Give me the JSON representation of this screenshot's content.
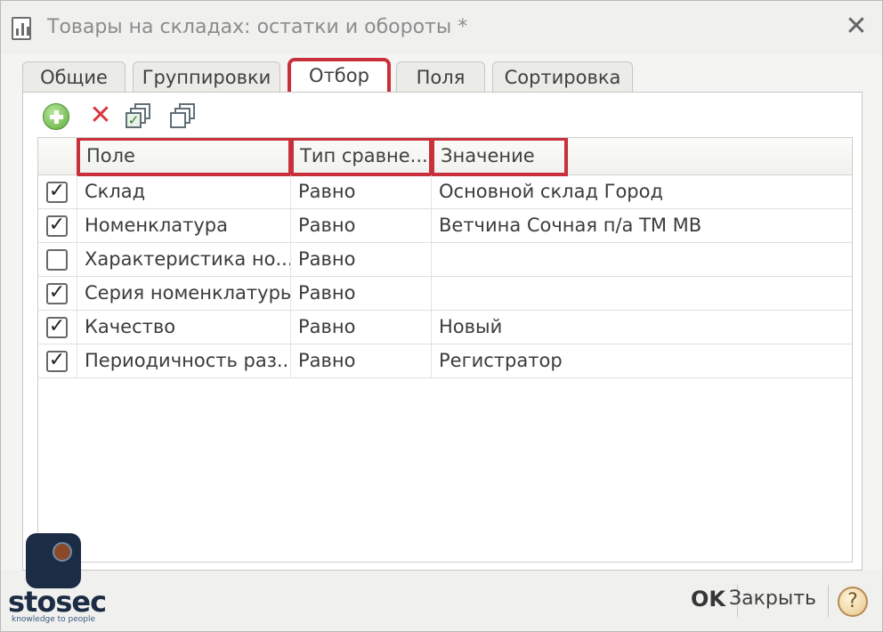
{
  "window": {
    "title": "Товары на складах: остатки и обороты *"
  },
  "tabs": [
    {
      "label": "Общие"
    },
    {
      "label": "Группировки"
    },
    {
      "label": "Отбор",
      "active": true
    },
    {
      "label": "Поля"
    },
    {
      "label": "Сортировка"
    }
  ],
  "toolbar": {
    "icons": [
      "add-icon",
      "delete-icon",
      "check-all-icon",
      "uncheck-all-icon"
    ]
  },
  "table": {
    "columns": [
      "Поле",
      "Тип сравне...",
      "Значение"
    ],
    "rows": [
      {
        "checked": true,
        "field": "Склад",
        "comparison": "Равно",
        "value": "Основной склад Город"
      },
      {
        "checked": true,
        "field": "Номенклатура",
        "comparison": "Равно",
        "value": "Ветчина Сочная п/а  ТМ МВ"
      },
      {
        "checked": false,
        "field": "Характеристика но...",
        "comparison": "Равно",
        "value": ""
      },
      {
        "checked": true,
        "field": "Серия номенклатуры",
        "comparison": "Равно",
        "value": ""
      },
      {
        "checked": true,
        "field": "Качество",
        "comparison": "Равно",
        "value": "Новый"
      },
      {
        "checked": true,
        "field": "Периодичность раз...",
        "comparison": "Равно",
        "value": "Регистратор"
      }
    ]
  },
  "footer": {
    "ok_label": "OK",
    "close_label": "Закрыть",
    "help_label": "?"
  },
  "watermark": {
    "text": "stosec",
    "subtext": "knowledge to people"
  },
  "colors": {
    "highlight": "#c8313b"
  }
}
